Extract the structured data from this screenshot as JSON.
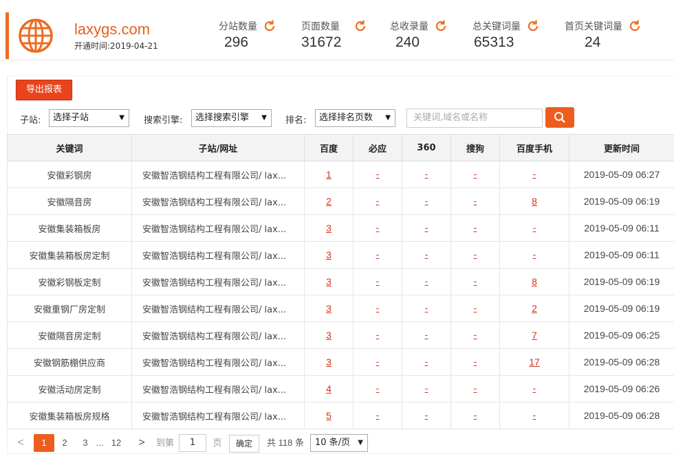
{
  "header": {
    "site_name": "laxygs.com",
    "open_time_label": "开通时间:",
    "open_time": "2019-04-21",
    "stats": [
      {
        "label": "分站数量",
        "value": "296"
      },
      {
        "label": "页面数量",
        "value": "31672"
      },
      {
        "label": "总收录量",
        "value": "240"
      },
      {
        "label": "总关键词量",
        "value": "65313"
      },
      {
        "label": "首页关键词量",
        "value": "24"
      }
    ],
    "accent_color": "#ee6c21"
  },
  "toolbar": {
    "export_label": "导出报表",
    "substation_label": "子站:",
    "substation_value": "选择子站",
    "engine_label": "搜索引擎:",
    "engine_value": "选择搜索引擎",
    "rank_label": "排名:",
    "rank_value": "选择排名页数",
    "search_placeholder": "关键词,域名或名称"
  },
  "table": {
    "headers": [
      "关键词",
      "子站/网址",
      "百度",
      "必应",
      "360",
      "搜狗",
      "百度手机",
      "更新时间"
    ],
    "rows": [
      {
        "keyword": "安徽彩钢房",
        "site": "安徽智浩钢结构工程有限公司/ lax...",
        "baidu": "1",
        "bing": "-",
        "s360": "-",
        "sogou": "-",
        "mobile": "-",
        "time": "2019-05-09 06:27"
      },
      {
        "keyword": "安徽隔音房",
        "site": "安徽智浩钢结构工程有限公司/ lax...",
        "baidu": "2",
        "bing": "-",
        "s360": "-",
        "sogou": "-",
        "mobile": "8",
        "time": "2019-05-09 06:19"
      },
      {
        "keyword": "安徽集装箱板房",
        "site": "安徽智浩钢结构工程有限公司/ lax...",
        "baidu": "3",
        "bing": "-",
        "s360": "-",
        "sogou": "-",
        "mobile": "-",
        "time": "2019-05-09 06:11"
      },
      {
        "keyword": "安徽集装箱板房定制",
        "site": "安徽智浩钢结构工程有限公司/ lax...",
        "baidu": "3",
        "bing": "-",
        "s360": "-",
        "sogou": "-",
        "mobile": "-",
        "time": "2019-05-09 06:11"
      },
      {
        "keyword": "安徽彩钢板定制",
        "site": "安徽智浩钢结构工程有限公司/ lax...",
        "baidu": "3",
        "bing": "-",
        "s360": "-",
        "sogou": "-",
        "mobile": "8",
        "time": "2019-05-09 06:19"
      },
      {
        "keyword": "安徽重钢厂房定制",
        "site": "安徽智浩钢结构工程有限公司/ lax...",
        "baidu": "3",
        "bing": "-",
        "s360": "-",
        "sogou": "-",
        "mobile": "2",
        "time": "2019-05-09 06:19"
      },
      {
        "keyword": "安徽隔音房定制",
        "site": "安徽智浩钢结构工程有限公司/ lax...",
        "baidu": "3",
        "bing": "-",
        "s360": "-",
        "sogou": "-",
        "mobile": "7",
        "time": "2019-05-09 06:25"
      },
      {
        "keyword": "安徽钢筋棚供应商",
        "site": "安徽智浩钢结构工程有限公司/ lax...",
        "baidu": "3",
        "bing": "-",
        "s360": "-",
        "sogou": "-",
        "mobile": "17",
        "time": "2019-05-09 06:28"
      },
      {
        "keyword": "安徽活动房定制",
        "site": "安徽智浩钢结构工程有限公司/ lax...",
        "baidu": "4",
        "bing": "-",
        "s360": "-",
        "sogou": "-",
        "mobile": "-",
        "time": "2019-05-09 06:26"
      },
      {
        "keyword": "安徽集装箱板房规格",
        "site": "安徽智浩钢结构工程有限公司/ lax...",
        "baidu": "5",
        "bing": "-",
        "s360": "-",
        "sogou": "-",
        "mobile": "-",
        "time": "2019-05-09 06:28"
      }
    ]
  },
  "pager": {
    "prev": "<",
    "pages": [
      "1",
      "2",
      "3"
    ],
    "ellipsis": "...",
    "last_page": "12",
    "next": ">",
    "goto_label": "到第",
    "goto_value": "1",
    "page_unit": "页",
    "ok_label": "确定",
    "total_text": "共 118 条",
    "page_size": "10 条/页"
  }
}
